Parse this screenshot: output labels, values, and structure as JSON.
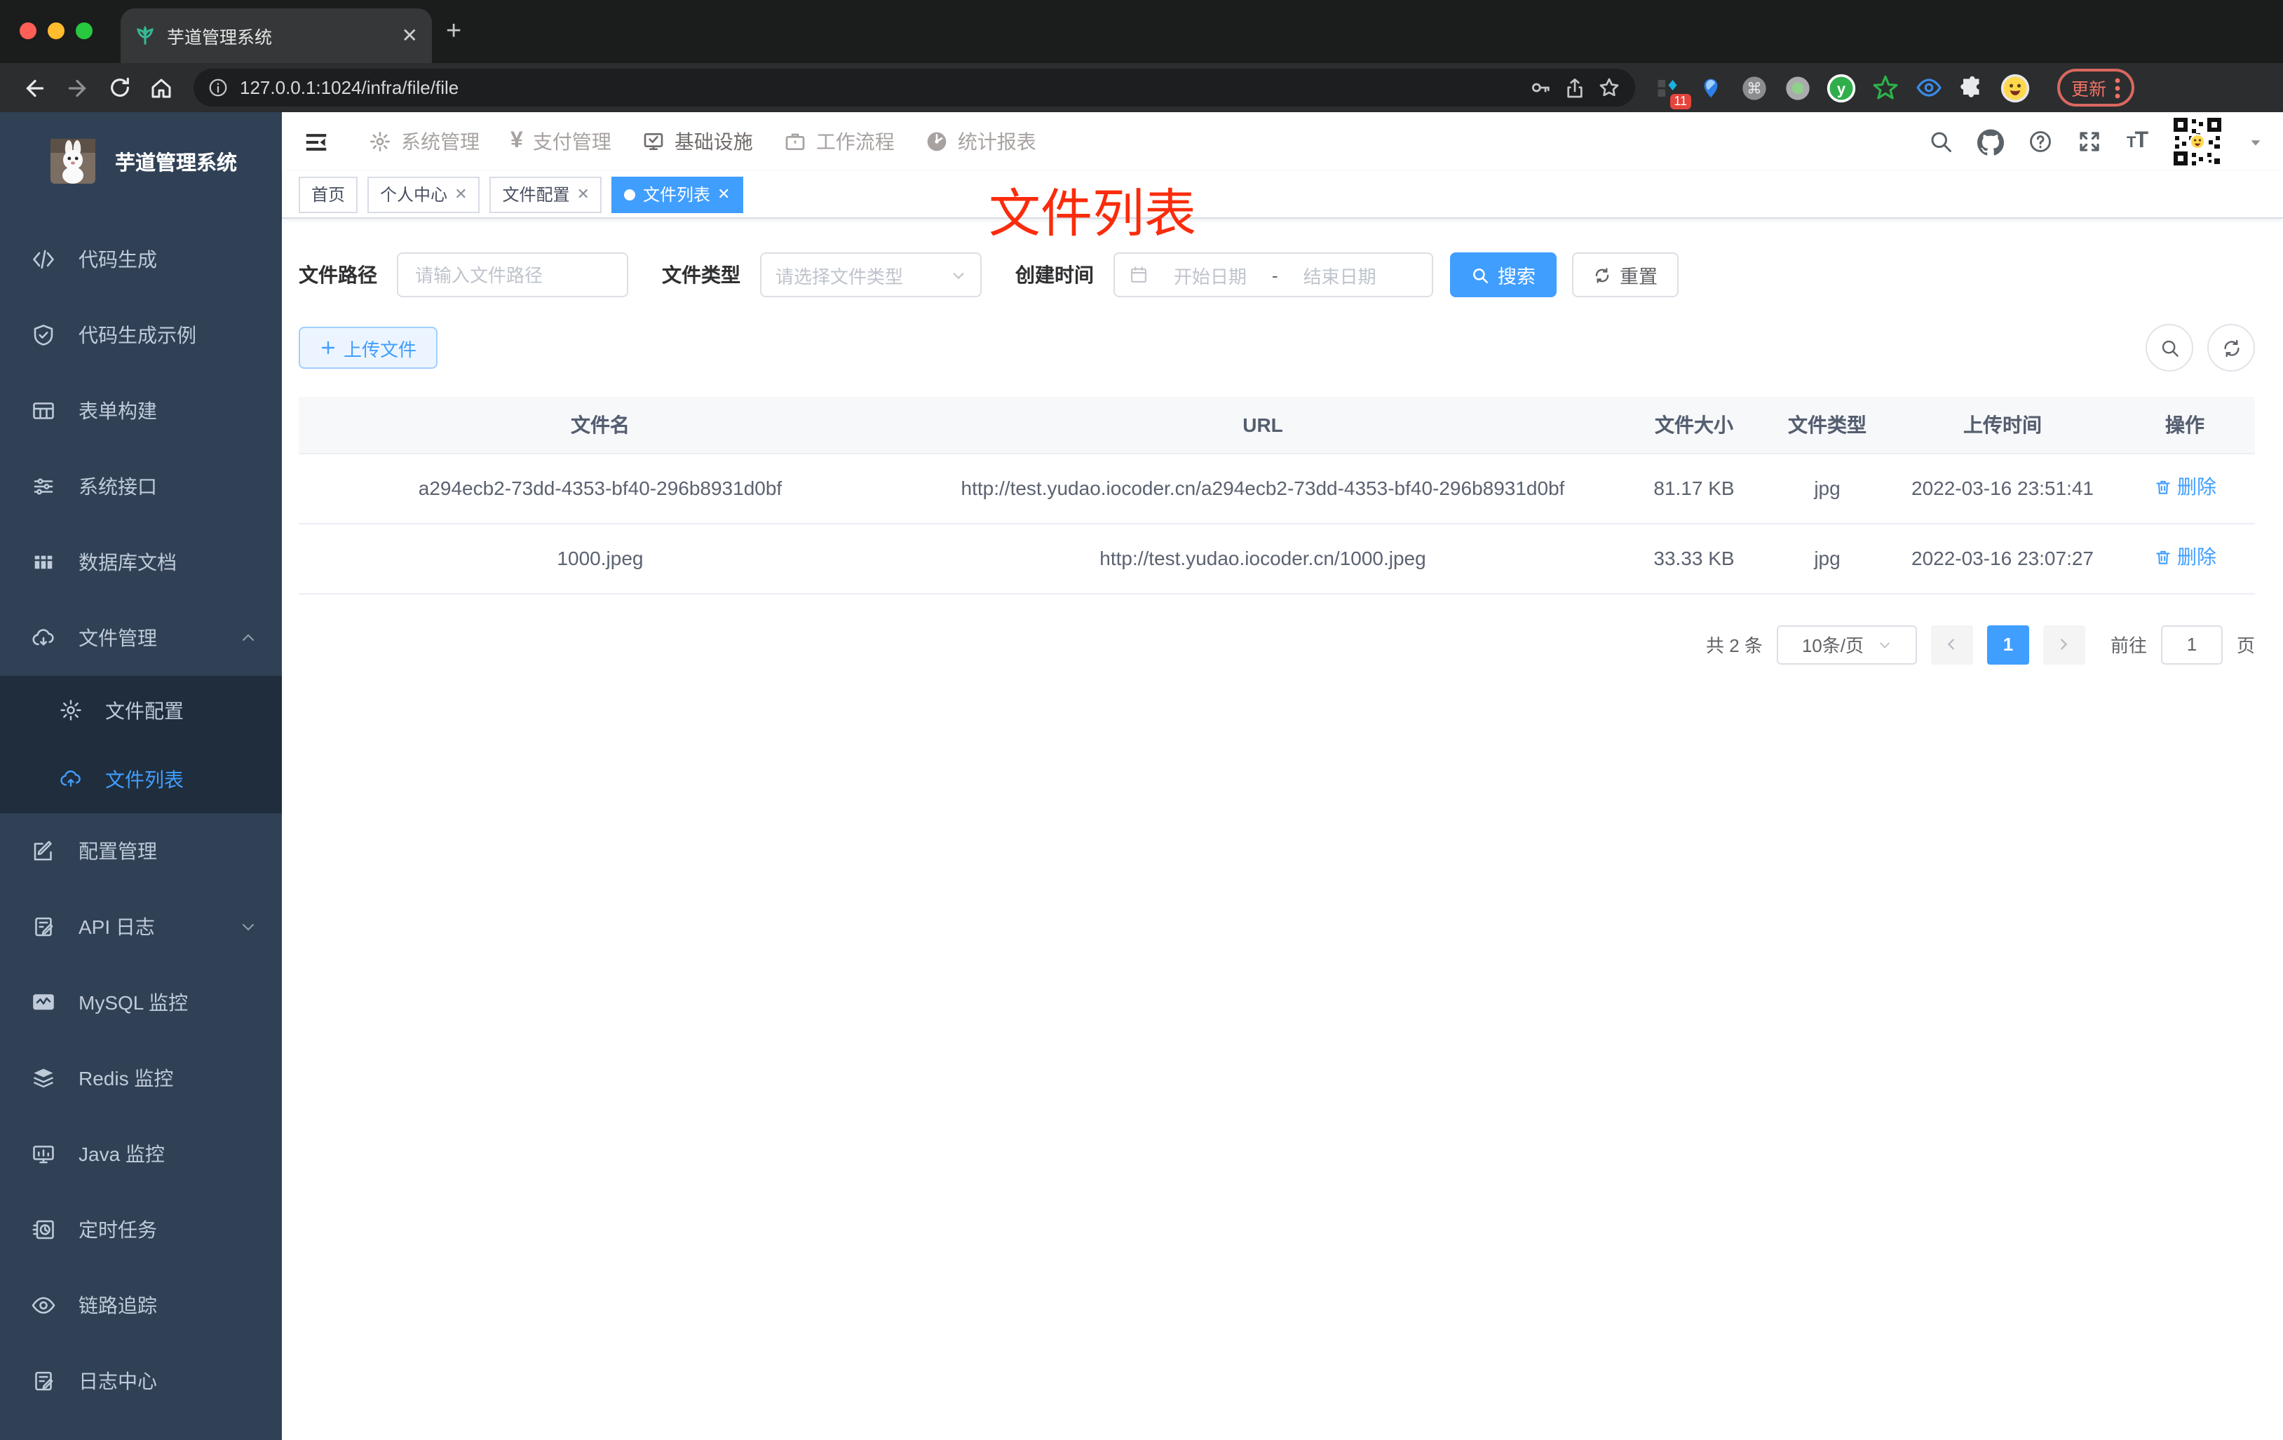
{
  "colors": {
    "accent": "#409eff",
    "sidebar_bg": "#304156",
    "submenu_bg": "#1f2d3d",
    "annotation_red": "#fa2c0c",
    "tab_active_bg": "#409eff"
  },
  "browser": {
    "tab_title": "芋道管理系统",
    "url": "127.0.0.1:1024/infra/file/file",
    "update_label": "更新",
    "extension_badge": "11"
  },
  "topnav": {
    "items": [
      {
        "label": "系统管理"
      },
      {
        "label": "支付管理"
      },
      {
        "label": "基础设施"
      },
      {
        "label": "工作流程"
      },
      {
        "label": "统计报表"
      }
    ]
  },
  "sidebar": {
    "title": "芋道管理系统",
    "items_top": [
      {
        "label": "代码生成"
      },
      {
        "label": "代码生成示例"
      },
      {
        "label": "表单构建"
      },
      {
        "label": "系统接口"
      },
      {
        "label": "数据库文档"
      }
    ],
    "file_group": {
      "label": "文件管理",
      "children": [
        {
          "label": "文件配置"
        },
        {
          "label": "文件列表"
        }
      ]
    },
    "items_bottom": [
      {
        "label": "配置管理"
      },
      {
        "label": "API 日志"
      },
      {
        "label": "MySQL 监控"
      },
      {
        "label": "Redis 监控"
      },
      {
        "label": "Java 监控"
      },
      {
        "label": "定时任务"
      },
      {
        "label": "链路追踪"
      },
      {
        "label": "日志中心"
      }
    ]
  },
  "tags": [
    {
      "label": "首页"
    },
    {
      "label": "个人中心"
    },
    {
      "label": "文件配置"
    },
    {
      "label": "文件列表"
    }
  ],
  "annotation": "文件列表",
  "filter": {
    "path_label": "文件路径",
    "path_placeholder": "请输入文件路径",
    "type_label": "文件类型",
    "type_placeholder": "请选择文件类型",
    "date_label": "创建时间",
    "date_start_placeholder": "开始日期",
    "date_separator": "-",
    "date_end_placeholder": "结束日期",
    "search_label": "搜索",
    "reset_label": "重置"
  },
  "actions": {
    "upload_label": "上传文件"
  },
  "table": {
    "columns": [
      "文件名",
      "URL",
      "文件大小",
      "文件类型",
      "上传时间",
      "操作"
    ],
    "rows": [
      {
        "name": "a294ecb2-73dd-4353-bf40-296b8931d0bf",
        "url": "http://test.yudao.iocoder.cn/a294ecb2-73dd-4353-bf40-296b8931d0bf",
        "size": "81.17 KB",
        "type": "jpg",
        "time": "2022-03-16 23:51:41",
        "action": "删除"
      },
      {
        "name": "1000.jpeg",
        "url": "http://test.yudao.iocoder.cn/1000.jpeg",
        "size": "33.33 KB",
        "type": "jpg",
        "time": "2022-03-16 23:07:27",
        "action": "删除"
      }
    ]
  },
  "pagination": {
    "total": "共 2 条",
    "page_size": "10条/页",
    "current_page": "1",
    "goto_label": "前往",
    "goto_value": "1",
    "page_unit": "页"
  }
}
